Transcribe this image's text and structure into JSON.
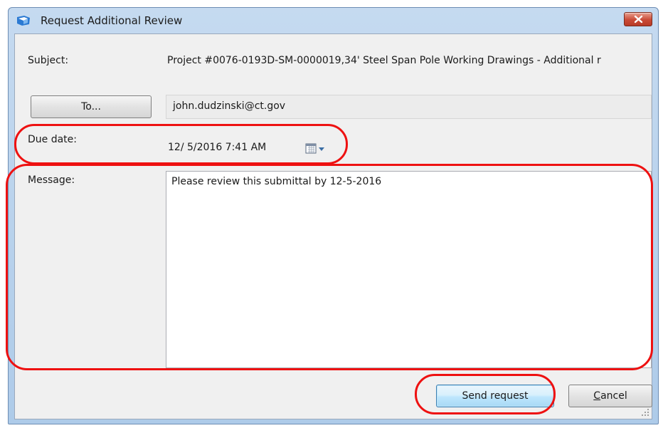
{
  "window": {
    "title": "Request Additional Review",
    "accent_color": "#6d8db3",
    "close_icon": "close-icon"
  },
  "form": {
    "subject_label": "Subject:",
    "subject_value": "Project #0076-0193D-SM-0000019,34' Steel Span Pole Working Drawings - Additional r",
    "to_button_label": "To...",
    "to_value": "john.dudzinski@ct.gov",
    "due_date_label": "Due date:",
    "due_date_value": "12/  5/2016   7:41 AM",
    "message_label": "Message:",
    "message_value": "Please review this submittal by 12-5-2016"
  },
  "buttons": {
    "send_label": "Send request",
    "cancel_label": "Cancel"
  },
  "annotations": {
    "highlight_color": "#ee1111"
  }
}
